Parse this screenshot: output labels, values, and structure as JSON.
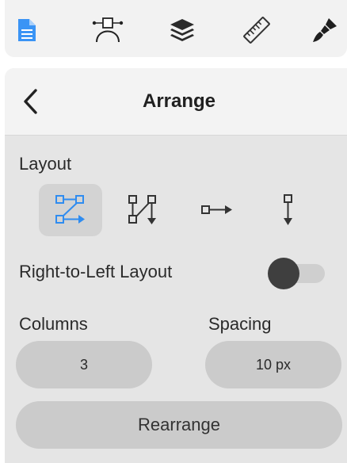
{
  "toolbar": {
    "tools": [
      {
        "icon": "document-icon",
        "active": true
      },
      {
        "icon": "bezier-curve-icon",
        "active": false
      },
      {
        "icon": "layers-icon",
        "active": false
      },
      {
        "icon": "ruler-icon",
        "active": false
      },
      {
        "icon": "paint-brush-icon",
        "active": false
      }
    ],
    "accent_color": "#2f8cf0"
  },
  "panel": {
    "title": "Arrange",
    "back_icon": "chevron-left-icon"
  },
  "layout": {
    "label": "Layout",
    "options": [
      {
        "icon": "layout-zigzag-icon",
        "selected": true
      },
      {
        "icon": "layout-vertical-flow-icon",
        "selected": false
      },
      {
        "icon": "layout-horizontal-icon",
        "selected": false
      },
      {
        "icon": "layout-vertical-icon",
        "selected": false
      }
    ]
  },
  "rtl": {
    "label": "Right-to-Left Layout",
    "enabled": false
  },
  "columns": {
    "label": "Columns",
    "value": "3"
  },
  "spacing": {
    "label": "Spacing",
    "value": "10 px"
  },
  "rearrange_label": "Rearrange"
}
